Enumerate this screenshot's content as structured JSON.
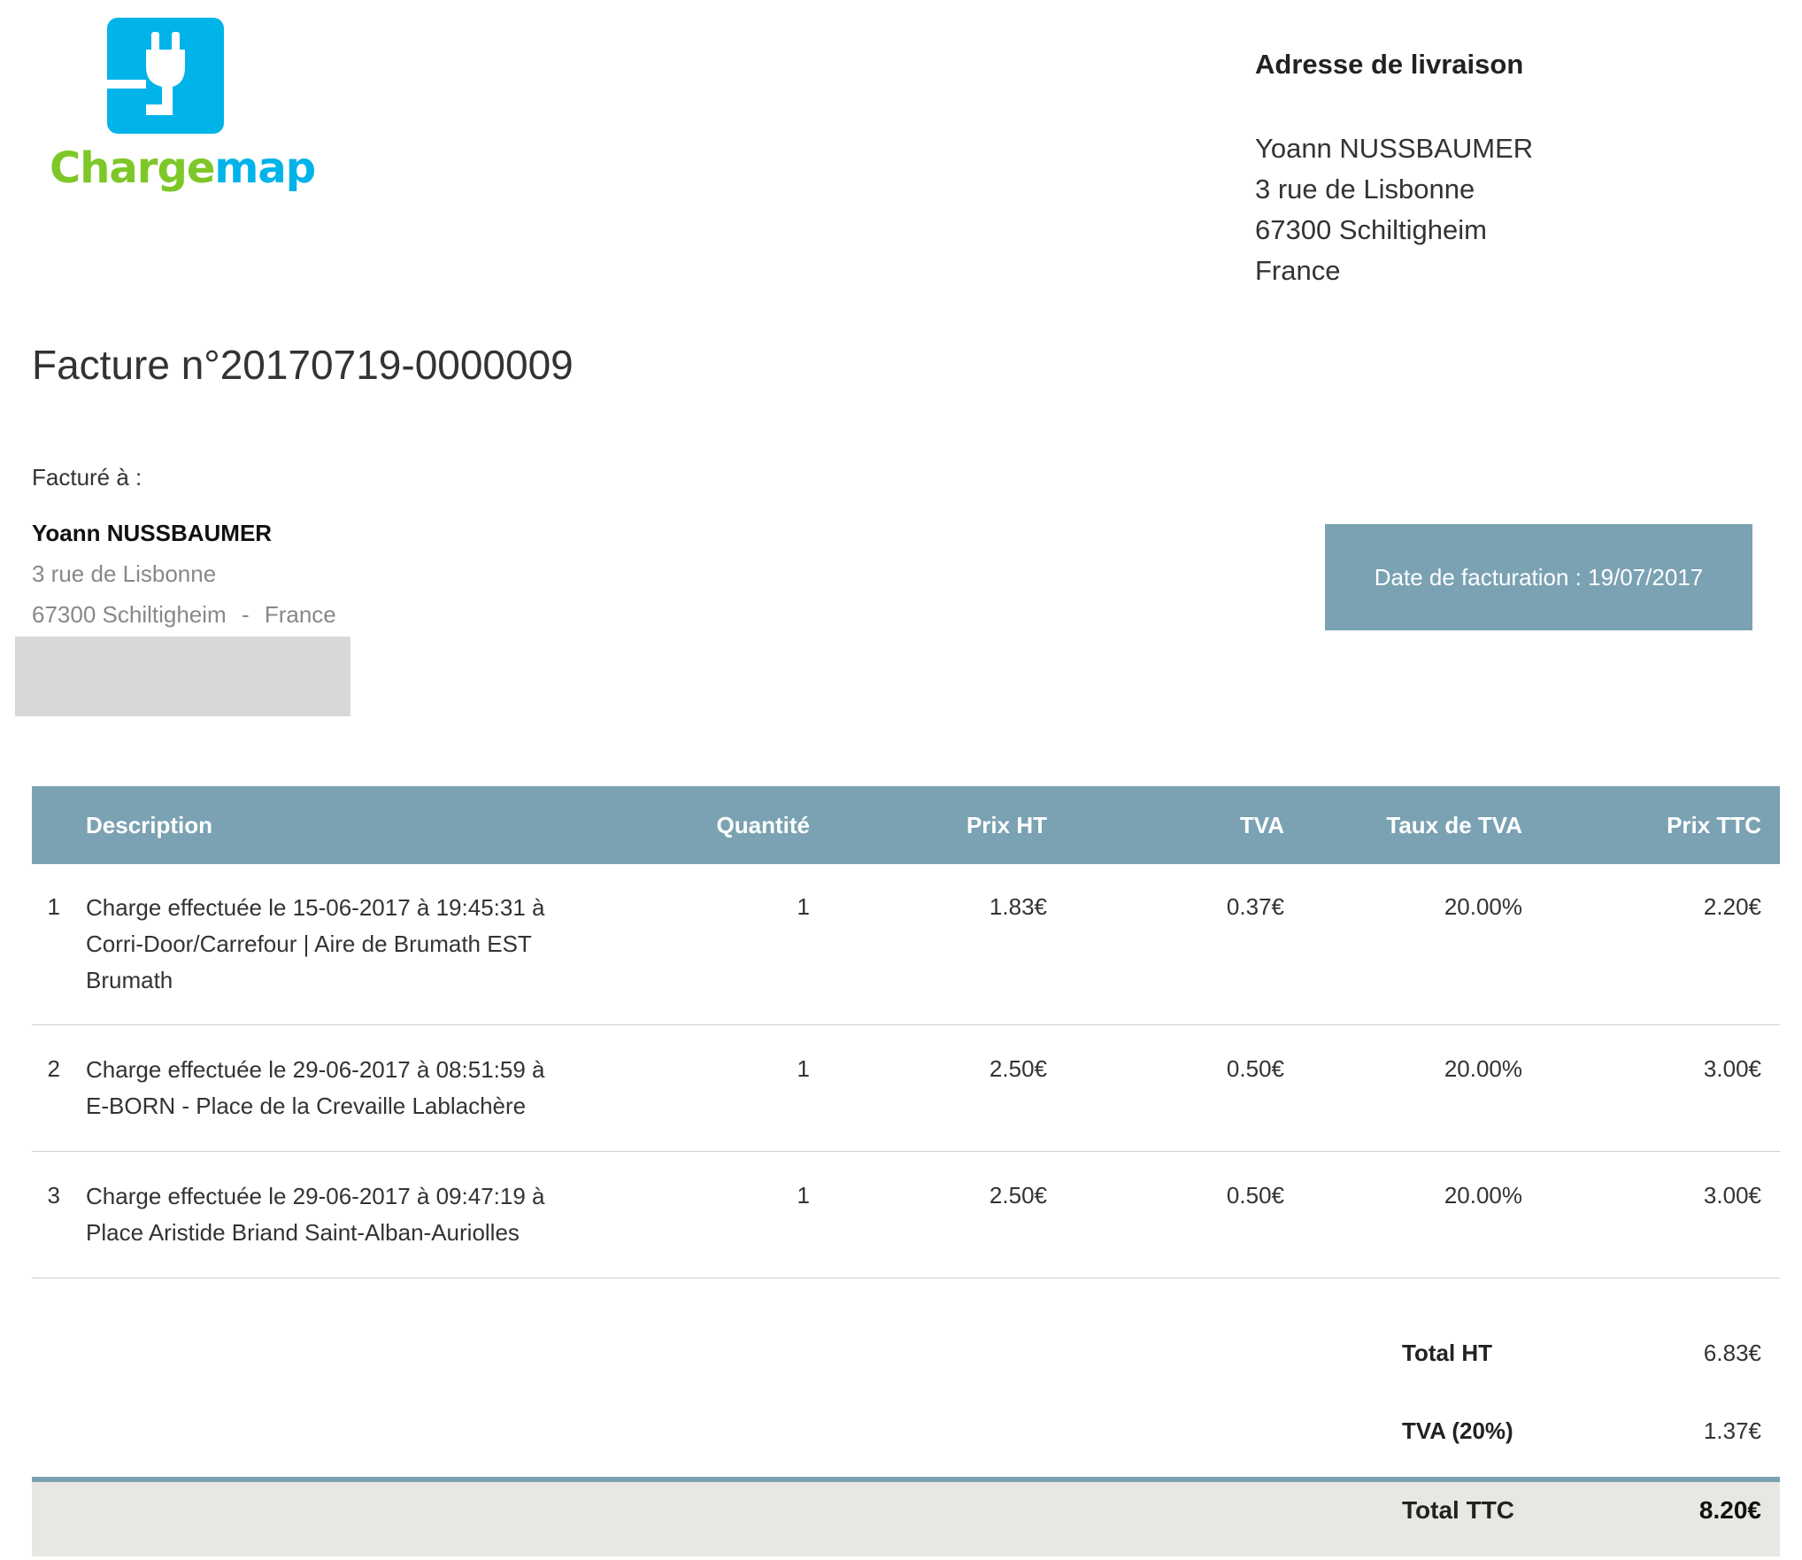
{
  "brand": {
    "name_part1": "Charge",
    "name_part2": "map",
    "icon": "plug-icon",
    "colors": {
      "blue": "#00b3e9",
      "green": "#7dc828",
      "table_header": "#7aa2b3"
    }
  },
  "shipping": {
    "heading": "Adresse de livraison",
    "name": "Yoann NUSSBAUMER",
    "street": "3 rue de Lisbonne",
    "city": "67300 Schiltigheim",
    "country": "France"
  },
  "invoice": {
    "title": "Facture n°20170719-0000009",
    "date_label": "Date de facturation : 19/07/2017"
  },
  "billed_to": {
    "label": "Facturé à :",
    "name": "Yoann NUSSBAUMER",
    "street": "3 rue de Lisbonne",
    "city": "67300 Schiltigheim",
    "separator": "-",
    "country": "France"
  },
  "table": {
    "headers": {
      "description": "Description",
      "quantity": "Quantité",
      "price_ht": "Prix HT",
      "tva": "TVA",
      "tva_rate": "Taux de TVA",
      "price_ttc": "Prix TTC"
    },
    "rows": [
      {
        "num": "1",
        "desc_lines": [
          "Charge effectuée le 15-06-2017 à 19:45:31 à",
          "Corri-Door/Carrefour | Aire de Brumath EST",
          "Brumath"
        ],
        "quantity": "1",
        "price_ht": "1.83€",
        "tva": "0.37€",
        "tva_rate": "20.00%",
        "price_ttc": "2.20€"
      },
      {
        "num": "2",
        "desc_lines": [
          "Charge effectuée le 29-06-2017 à 08:51:59 à",
          "E-BORN - Place de la Crevaille Lablachère"
        ],
        "quantity": "1",
        "price_ht": "2.50€",
        "tva": "0.50€",
        "tva_rate": "20.00%",
        "price_ttc": "3.00€"
      },
      {
        "num": "3",
        "desc_lines": [
          "Charge effectuée le 29-06-2017 à 09:47:19 à",
          "Place Aristide Briand Saint-Alban-Auriolles"
        ],
        "quantity": "1",
        "price_ht": "2.50€",
        "tva": "0.50€",
        "tva_rate": "20.00%",
        "price_ttc": "3.00€"
      }
    ]
  },
  "totals": {
    "ht_label": "Total HT",
    "ht_value": "6.83€",
    "tva_label": "TVA (20%)",
    "tva_value": "1.37€",
    "ttc_label": "Total TTC",
    "ttc_value": "8.20€"
  }
}
